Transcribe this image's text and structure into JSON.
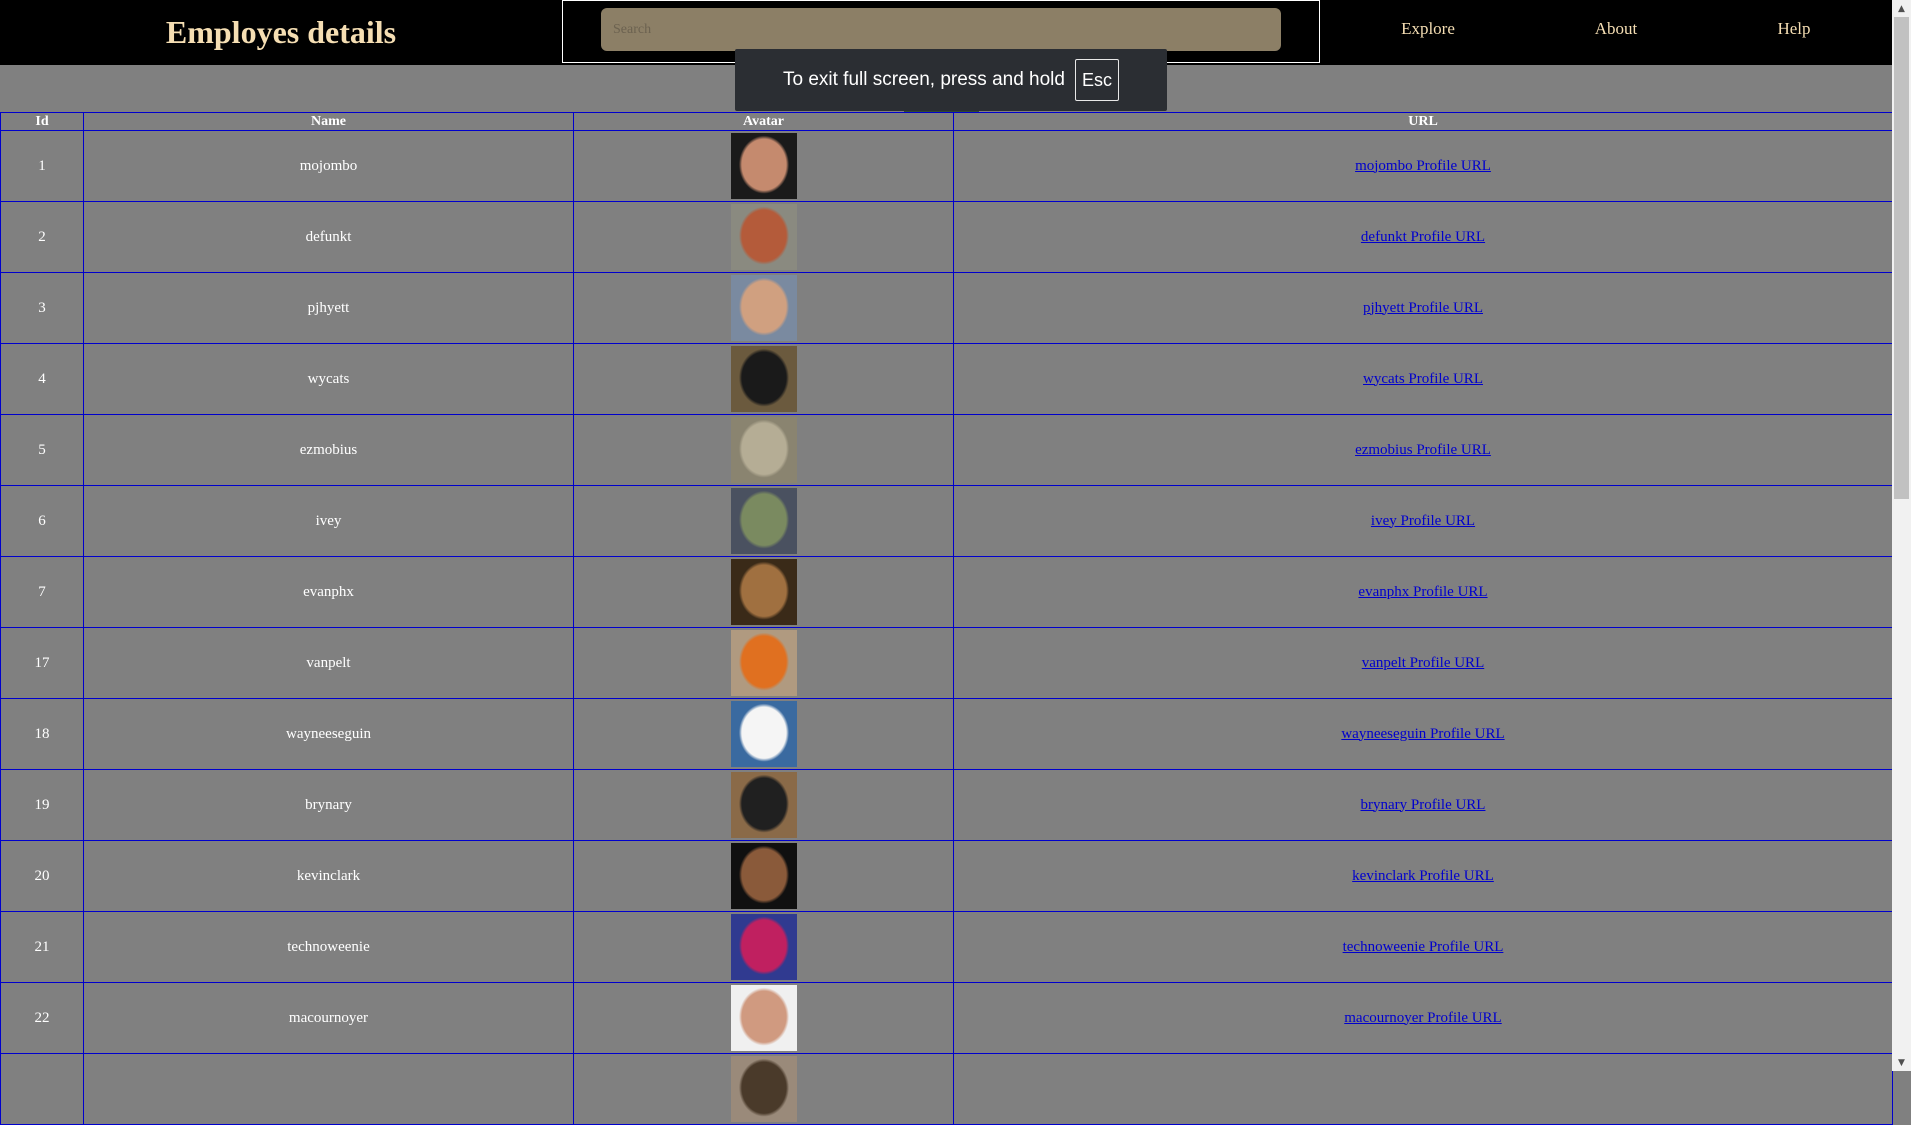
{
  "header": {
    "title": "Employes details",
    "search_placeholder": "Search",
    "nav": [
      "Explore",
      "About",
      "Help"
    ]
  },
  "fullscreen_toast": {
    "message": "To exit full screen, press and hold",
    "key": "Esc"
  },
  "table": {
    "columns": [
      "Id",
      "Name",
      "Avatar",
      "URL"
    ],
    "rows": [
      {
        "id": "1",
        "name": "mojombo",
        "url": "mojombo Profile URL",
        "avatar_colors": [
          "#1a1a1a",
          "#c58a6e"
        ]
      },
      {
        "id": "2",
        "name": "defunkt",
        "url": "defunkt Profile URL",
        "avatar_colors": [
          "#8a8a80",
          "#b45b3a"
        ]
      },
      {
        "id": "3",
        "name": "pjhyett",
        "url": "pjhyett Profile URL",
        "avatar_colors": [
          "#7a8aa0",
          "#d0a080"
        ]
      },
      {
        "id": "4",
        "name": "wycats",
        "url": "wycats Profile URL",
        "avatar_colors": [
          "#6b5a3e",
          "#1a1a1a"
        ]
      },
      {
        "id": "5",
        "name": "ezmobius",
        "url": "ezmobius Profile URL",
        "avatar_colors": [
          "#8a8470",
          "#b5ad95"
        ]
      },
      {
        "id": "6",
        "name": "ivey",
        "url": "ivey Profile URL",
        "avatar_colors": [
          "#4a5160",
          "#7a8a60"
        ]
      },
      {
        "id": "7",
        "name": "evanphx",
        "url": "evanphx Profile URL",
        "avatar_colors": [
          "#3a2a18",
          "#a07040"
        ]
      },
      {
        "id": "17",
        "name": "vanpelt",
        "url": "vanpelt Profile URL",
        "avatar_colors": [
          "#b09a80",
          "#e07020"
        ]
      },
      {
        "id": "18",
        "name": "wayneeseguin",
        "url": "wayneeseguin Profile URL",
        "avatar_colors": [
          "#3a6aa0",
          "#f5f5f5"
        ]
      },
      {
        "id": "19",
        "name": "brynary",
        "url": "brynary Profile URL",
        "avatar_colors": [
          "#8a6a48",
          "#202020"
        ]
      },
      {
        "id": "20",
        "name": "kevinclark",
        "url": "kevinclark Profile URL",
        "avatar_colors": [
          "#101010",
          "#8a5a3a"
        ]
      },
      {
        "id": "21",
        "name": "technoweenie",
        "url": "technoweenie Profile URL",
        "avatar_colors": [
          "#303a90",
          "#c02060"
        ]
      },
      {
        "id": "22",
        "name": "macournoyer",
        "url": "macournoyer Profile URL",
        "avatar_colors": [
          "#f0f0f0",
          "#d09a80"
        ]
      },
      {
        "id": "",
        "name": "",
        "url": "",
        "avatar_colors": [
          "#9a8a7a",
          "#4a3a2a"
        ]
      }
    ]
  },
  "colors": {
    "topbar": "#000000",
    "brand_text": "#f5deb3",
    "search_bg": "#8c7f66",
    "page_bg": "#808080",
    "table_border": "#0000cd",
    "link": "#0000cd"
  }
}
